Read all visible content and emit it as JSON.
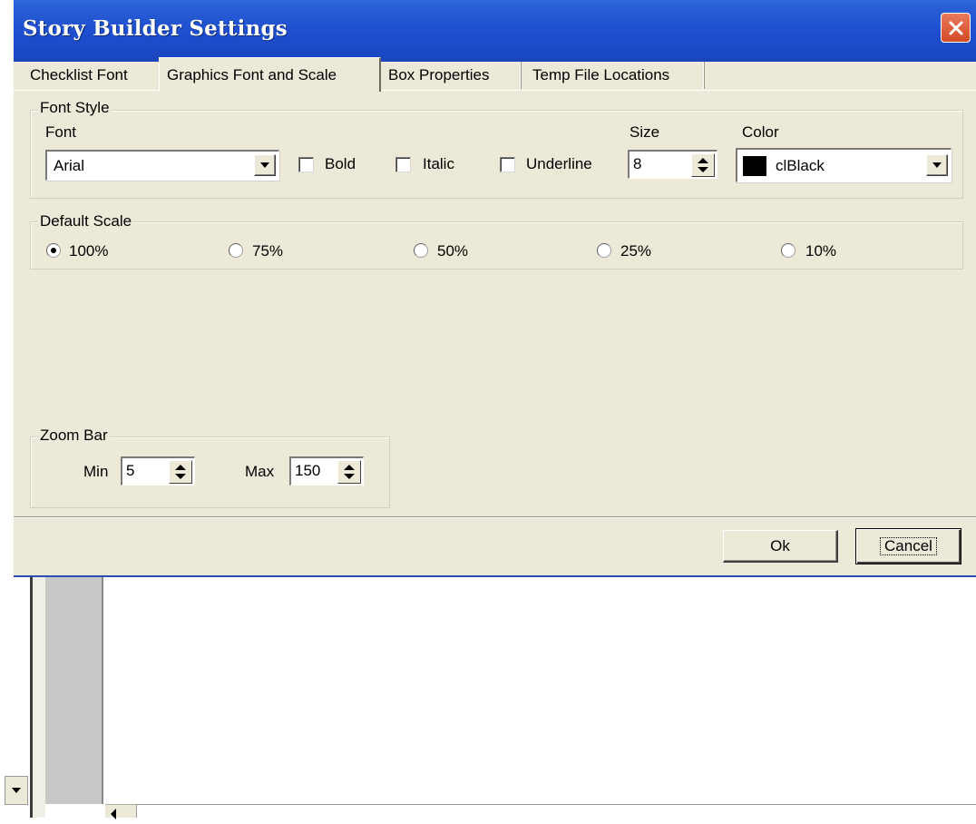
{
  "window": {
    "title": "Story Builder Settings"
  },
  "tabs": [
    {
      "label": "Checklist Font"
    },
    {
      "label": "Graphics Font and Scale"
    },
    {
      "label": "Box Properties"
    },
    {
      "label": "Temp File Locations"
    }
  ],
  "font_style": {
    "legend": "Font Style",
    "font_label": "Font",
    "font_value": "Arial",
    "bold_label": "Bold",
    "italic_label": "Italic",
    "underline_label": "Underline",
    "size_label": "Size",
    "size_value": "8",
    "color_label": "Color",
    "color_value": "clBlack",
    "color_swatch": "#000000"
  },
  "default_scale": {
    "legend": "Default Scale",
    "options": [
      "100%",
      "75%",
      "50%",
      "25%",
      "10%"
    ],
    "selected": "100%"
  },
  "zoom_bar": {
    "legend": "Zoom Bar",
    "min_label": "Min",
    "min_value": "5",
    "max_label": "Max",
    "max_value": "150"
  },
  "buttons": {
    "ok": "Ok",
    "cancel": "Cancel"
  },
  "colors": {
    "titlebar": "#1e4fcf",
    "dialog_bg": "#ece9d8",
    "close_button": "#d34a26"
  }
}
